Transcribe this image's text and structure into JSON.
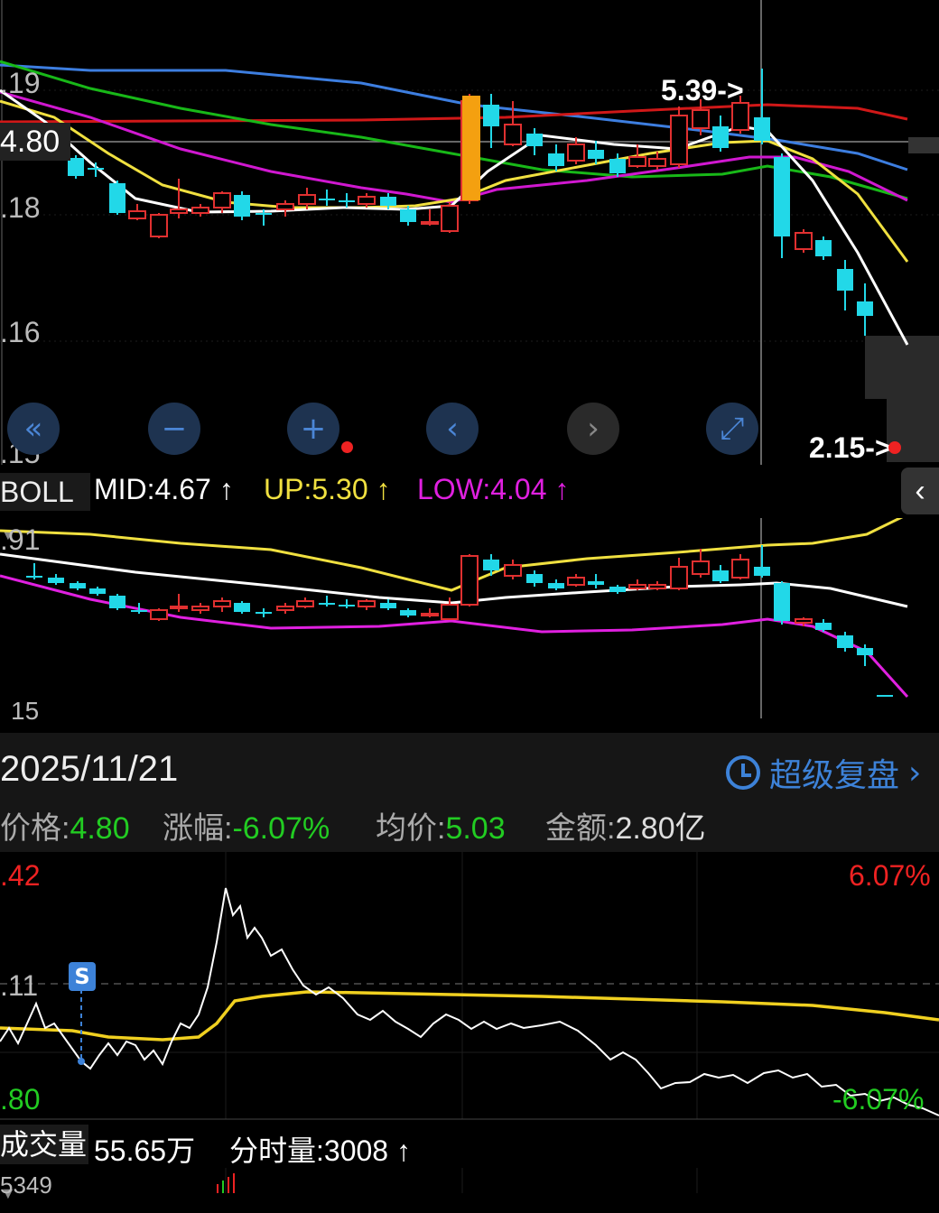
{
  "kline": {
    "axis_labels": [
      ".19",
      "4.80",
      ".18",
      ".16",
      ".15"
    ],
    "annotation_high": "5.39->",
    "annotation_low": "2.15->"
  },
  "controls": [
    {
      "name": "scroll-start-button",
      "glyph": "«"
    },
    {
      "name": "zoom-out-button",
      "glyph": "−"
    },
    {
      "name": "zoom-in-button",
      "glyph": "+"
    },
    {
      "name": "prev-button",
      "glyph": "‹"
    },
    {
      "name": "next-button",
      "glyph": "›"
    },
    {
      "name": "fullscreen-button",
      "glyph": "⤢"
    }
  ],
  "boll": {
    "name": "BOLL",
    "mid": "MID:4.67",
    "up": "UP:5.30",
    "low": "LOW:4.04",
    "arrow": "↑",
    "axis_top": ".91",
    "axis_bottom": "15",
    "colors": {
      "mid": "#ffffff",
      "up": "#f0e040",
      "low": "#e020e0"
    }
  },
  "info": {
    "date": "2025/11/21",
    "replay_label": "超级复盘",
    "price_label": "价格:",
    "price_value": "4.80",
    "change_label": "涨幅:",
    "change_value": "-6.07%",
    "avg_label": "均价:",
    "avg_value": "5.03",
    "amount_label": "金额:",
    "amount_value": "2.80亿"
  },
  "intraday": {
    "axis_top_left": ".42",
    "axis_top_right": "6.07%",
    "axis_mid_left": ".11",
    "axis_bottom_left": ".80",
    "axis_bottom_right": "-6.07%",
    "marker": "S"
  },
  "volume": {
    "name": "成交量",
    "total": "55.65万",
    "minute": "分时量:3008",
    "arrow": "↑",
    "axis": "5349"
  },
  "colors": {
    "up": "#e03030",
    "down": "#22d8e8",
    "accent": "#3d82d8",
    "green": "#22cc22",
    "red": "#ee2222",
    "yellow": "#f0d020"
  }
}
